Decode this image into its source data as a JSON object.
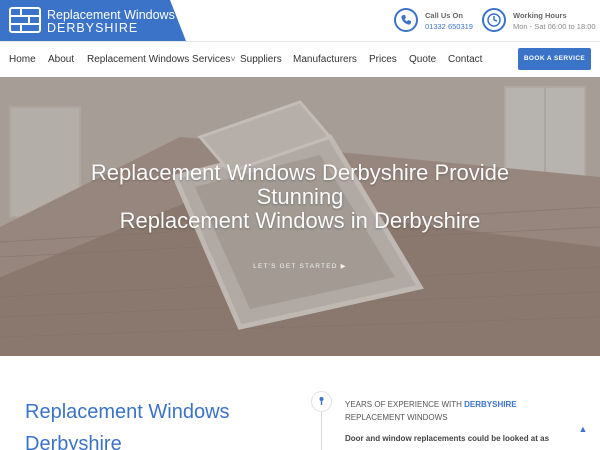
{
  "header": {
    "logo_line1": "Replacement Windows",
    "logo_line2": "DERBYSHIRE",
    "call_label": "Call Us On",
    "call_value": "01332 650319",
    "hours_label": "Working Hours",
    "hours_value": "Mon - Sat 06:00 to 18:00"
  },
  "nav": {
    "items": [
      "Home",
      "About",
      "Replacement Windows Services",
      "Suppliers",
      "Manufacturers",
      "Prices",
      "Quote",
      "Contact"
    ],
    "dropdown_marker": "˅",
    "book_button": "BOOK A SERVICE"
  },
  "hero": {
    "title_line1": "Replacement Windows Derbyshire Provide",
    "title_line2": "Stunning",
    "title_line3": "Replacement Windows in Derbyshire",
    "cta": "LET'S GET STARTED ▶"
  },
  "content": {
    "title_line1": "Replacement Windows",
    "title_line2": "Derbyshire",
    "experience_prefix": "YEARS OF EXPERIENCE WITH",
    "experience_highlight": "DERBYSHIRE",
    "experience_suffix": "REPLACEMENT WINDOWS",
    "paragraph": "Door and window replacements could be looked at as"
  },
  "icons": [
    "brick-logo-icon",
    "phone-icon",
    "clock-icon",
    "chevron-down-icon",
    "pin-icon",
    "scroll-up-icon"
  ],
  "colors": {
    "accent": "#3b73c8"
  }
}
